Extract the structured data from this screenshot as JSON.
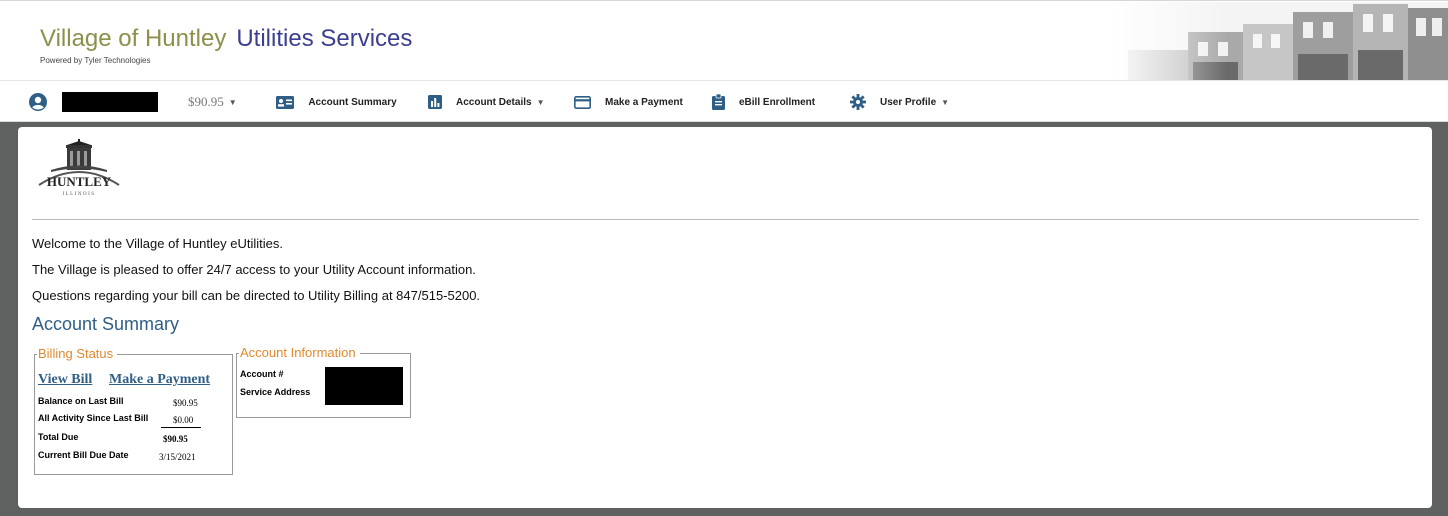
{
  "header": {
    "village": "Village of Huntley",
    "services": "Utilities Services",
    "powered_by": "Powered by Tyler Technologies"
  },
  "nav": {
    "balance": "$90.95",
    "account_summary": "Account Summary",
    "account_details": "Account Details",
    "make_payment": "Make a Payment",
    "ebill": "eBill Enrollment",
    "user_profile": "User Profile"
  },
  "logo": {
    "name": "HUNTLEY",
    "state": "ILLINOIS"
  },
  "welcome": {
    "line1": "Welcome to the Village of Huntley eUtilities.",
    "line2": "The Village is pleased to offer 24/7 access to your Utility Account information.",
    "line3": "Questions regarding your bill can be directed to Utility Billing at 847/515-5200."
  },
  "summary": {
    "heading": "Account Summary",
    "billing": {
      "legend": "Billing Status",
      "view_bill": "View Bill",
      "make_payment": "Make a Payment",
      "balance_label": "Balance on Last Bill",
      "balance_value": "$90.95",
      "activity_label": "All Activity Since Last Bill",
      "activity_value": "$0.00",
      "total_label": "Total Due",
      "total_value": "$90.95",
      "due_label": "Current Bill Due Date",
      "due_value": "3/15/2021"
    },
    "account": {
      "legend": "Account Information",
      "account_label": "Account #",
      "service_label": "Service Address"
    }
  },
  "colors": {
    "village_text": "#8d8f4a",
    "services_text": "#3c3f8f",
    "accent_blue": "#2f5e86",
    "legend_orange": "#e0892e",
    "frame_gray": "#5f6161"
  }
}
